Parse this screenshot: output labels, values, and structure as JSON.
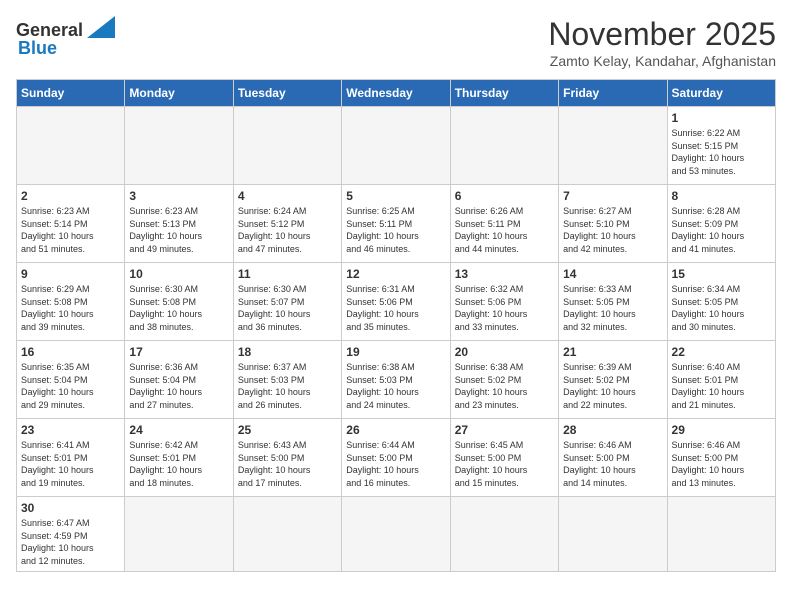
{
  "logo": {
    "line1": "General",
    "line2": "Blue"
  },
  "header": {
    "month_year": "November 2025",
    "location": "Zamto Kelay, Kandahar, Afghanistan"
  },
  "weekdays": [
    "Sunday",
    "Monday",
    "Tuesday",
    "Wednesday",
    "Thursday",
    "Friday",
    "Saturday"
  ],
  "weeks": [
    [
      {
        "day": "",
        "info": ""
      },
      {
        "day": "",
        "info": ""
      },
      {
        "day": "",
        "info": ""
      },
      {
        "day": "",
        "info": ""
      },
      {
        "day": "",
        "info": ""
      },
      {
        "day": "",
        "info": ""
      },
      {
        "day": "1",
        "info": "Sunrise: 6:22 AM\nSunset: 5:15 PM\nDaylight: 10 hours\nand 53 minutes."
      }
    ],
    [
      {
        "day": "2",
        "info": "Sunrise: 6:23 AM\nSunset: 5:14 PM\nDaylight: 10 hours\nand 51 minutes."
      },
      {
        "day": "3",
        "info": "Sunrise: 6:23 AM\nSunset: 5:13 PM\nDaylight: 10 hours\nand 49 minutes."
      },
      {
        "day": "4",
        "info": "Sunrise: 6:24 AM\nSunset: 5:12 PM\nDaylight: 10 hours\nand 47 minutes."
      },
      {
        "day": "5",
        "info": "Sunrise: 6:25 AM\nSunset: 5:11 PM\nDaylight: 10 hours\nand 46 minutes."
      },
      {
        "day": "6",
        "info": "Sunrise: 6:26 AM\nSunset: 5:11 PM\nDaylight: 10 hours\nand 44 minutes."
      },
      {
        "day": "7",
        "info": "Sunrise: 6:27 AM\nSunset: 5:10 PM\nDaylight: 10 hours\nand 42 minutes."
      },
      {
        "day": "8",
        "info": "Sunrise: 6:28 AM\nSunset: 5:09 PM\nDaylight: 10 hours\nand 41 minutes."
      }
    ],
    [
      {
        "day": "9",
        "info": "Sunrise: 6:29 AM\nSunset: 5:08 PM\nDaylight: 10 hours\nand 39 minutes."
      },
      {
        "day": "10",
        "info": "Sunrise: 6:30 AM\nSunset: 5:08 PM\nDaylight: 10 hours\nand 38 minutes."
      },
      {
        "day": "11",
        "info": "Sunrise: 6:30 AM\nSunset: 5:07 PM\nDaylight: 10 hours\nand 36 minutes."
      },
      {
        "day": "12",
        "info": "Sunrise: 6:31 AM\nSunset: 5:06 PM\nDaylight: 10 hours\nand 35 minutes."
      },
      {
        "day": "13",
        "info": "Sunrise: 6:32 AM\nSunset: 5:06 PM\nDaylight: 10 hours\nand 33 minutes."
      },
      {
        "day": "14",
        "info": "Sunrise: 6:33 AM\nSunset: 5:05 PM\nDaylight: 10 hours\nand 32 minutes."
      },
      {
        "day": "15",
        "info": "Sunrise: 6:34 AM\nSunset: 5:05 PM\nDaylight: 10 hours\nand 30 minutes."
      }
    ],
    [
      {
        "day": "16",
        "info": "Sunrise: 6:35 AM\nSunset: 5:04 PM\nDaylight: 10 hours\nand 29 minutes."
      },
      {
        "day": "17",
        "info": "Sunrise: 6:36 AM\nSunset: 5:04 PM\nDaylight: 10 hours\nand 27 minutes."
      },
      {
        "day": "18",
        "info": "Sunrise: 6:37 AM\nSunset: 5:03 PM\nDaylight: 10 hours\nand 26 minutes."
      },
      {
        "day": "19",
        "info": "Sunrise: 6:38 AM\nSunset: 5:03 PM\nDaylight: 10 hours\nand 24 minutes."
      },
      {
        "day": "20",
        "info": "Sunrise: 6:38 AM\nSunset: 5:02 PM\nDaylight: 10 hours\nand 23 minutes."
      },
      {
        "day": "21",
        "info": "Sunrise: 6:39 AM\nSunset: 5:02 PM\nDaylight: 10 hours\nand 22 minutes."
      },
      {
        "day": "22",
        "info": "Sunrise: 6:40 AM\nSunset: 5:01 PM\nDaylight: 10 hours\nand 21 minutes."
      }
    ],
    [
      {
        "day": "23",
        "info": "Sunrise: 6:41 AM\nSunset: 5:01 PM\nDaylight: 10 hours\nand 19 minutes."
      },
      {
        "day": "24",
        "info": "Sunrise: 6:42 AM\nSunset: 5:01 PM\nDaylight: 10 hours\nand 18 minutes."
      },
      {
        "day": "25",
        "info": "Sunrise: 6:43 AM\nSunset: 5:00 PM\nDaylight: 10 hours\nand 17 minutes."
      },
      {
        "day": "26",
        "info": "Sunrise: 6:44 AM\nSunset: 5:00 PM\nDaylight: 10 hours\nand 16 minutes."
      },
      {
        "day": "27",
        "info": "Sunrise: 6:45 AM\nSunset: 5:00 PM\nDaylight: 10 hours\nand 15 minutes."
      },
      {
        "day": "28",
        "info": "Sunrise: 6:46 AM\nSunset: 5:00 PM\nDaylight: 10 hours\nand 14 minutes."
      },
      {
        "day": "29",
        "info": "Sunrise: 6:46 AM\nSunset: 5:00 PM\nDaylight: 10 hours\nand 13 minutes."
      }
    ],
    [
      {
        "day": "30",
        "info": "Sunrise: 6:47 AM\nSunset: 4:59 PM\nDaylight: 10 hours\nand 12 minutes."
      },
      {
        "day": "",
        "info": ""
      },
      {
        "day": "",
        "info": ""
      },
      {
        "day": "",
        "info": ""
      },
      {
        "day": "",
        "info": ""
      },
      {
        "day": "",
        "info": ""
      },
      {
        "day": "",
        "info": ""
      }
    ]
  ]
}
